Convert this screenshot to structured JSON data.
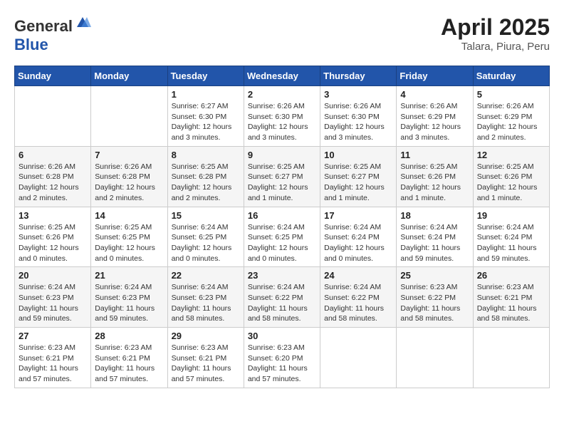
{
  "header": {
    "logo_general": "General",
    "logo_blue": "Blue",
    "month": "April 2025",
    "location": "Talara, Piura, Peru"
  },
  "weekdays": [
    "Sunday",
    "Monday",
    "Tuesday",
    "Wednesday",
    "Thursday",
    "Friday",
    "Saturday"
  ],
  "weeks": [
    [
      {
        "day": "",
        "info": ""
      },
      {
        "day": "",
        "info": ""
      },
      {
        "day": "1",
        "info": "Sunrise: 6:27 AM\nSunset: 6:30 PM\nDaylight: 12 hours and 3 minutes."
      },
      {
        "day": "2",
        "info": "Sunrise: 6:26 AM\nSunset: 6:30 PM\nDaylight: 12 hours and 3 minutes."
      },
      {
        "day": "3",
        "info": "Sunrise: 6:26 AM\nSunset: 6:30 PM\nDaylight: 12 hours and 3 minutes."
      },
      {
        "day": "4",
        "info": "Sunrise: 6:26 AM\nSunset: 6:29 PM\nDaylight: 12 hours and 3 minutes."
      },
      {
        "day": "5",
        "info": "Sunrise: 6:26 AM\nSunset: 6:29 PM\nDaylight: 12 hours and 2 minutes."
      }
    ],
    [
      {
        "day": "6",
        "info": "Sunrise: 6:26 AM\nSunset: 6:28 PM\nDaylight: 12 hours and 2 minutes."
      },
      {
        "day": "7",
        "info": "Sunrise: 6:26 AM\nSunset: 6:28 PM\nDaylight: 12 hours and 2 minutes."
      },
      {
        "day": "8",
        "info": "Sunrise: 6:25 AM\nSunset: 6:28 PM\nDaylight: 12 hours and 2 minutes."
      },
      {
        "day": "9",
        "info": "Sunrise: 6:25 AM\nSunset: 6:27 PM\nDaylight: 12 hours and 1 minute."
      },
      {
        "day": "10",
        "info": "Sunrise: 6:25 AM\nSunset: 6:27 PM\nDaylight: 12 hours and 1 minute."
      },
      {
        "day": "11",
        "info": "Sunrise: 6:25 AM\nSunset: 6:26 PM\nDaylight: 12 hours and 1 minute."
      },
      {
        "day": "12",
        "info": "Sunrise: 6:25 AM\nSunset: 6:26 PM\nDaylight: 12 hours and 1 minute."
      }
    ],
    [
      {
        "day": "13",
        "info": "Sunrise: 6:25 AM\nSunset: 6:26 PM\nDaylight: 12 hours and 0 minutes."
      },
      {
        "day": "14",
        "info": "Sunrise: 6:25 AM\nSunset: 6:25 PM\nDaylight: 12 hours and 0 minutes."
      },
      {
        "day": "15",
        "info": "Sunrise: 6:24 AM\nSunset: 6:25 PM\nDaylight: 12 hours and 0 minutes."
      },
      {
        "day": "16",
        "info": "Sunrise: 6:24 AM\nSunset: 6:25 PM\nDaylight: 12 hours and 0 minutes."
      },
      {
        "day": "17",
        "info": "Sunrise: 6:24 AM\nSunset: 6:24 PM\nDaylight: 12 hours and 0 minutes."
      },
      {
        "day": "18",
        "info": "Sunrise: 6:24 AM\nSunset: 6:24 PM\nDaylight: 11 hours and 59 minutes."
      },
      {
        "day": "19",
        "info": "Sunrise: 6:24 AM\nSunset: 6:24 PM\nDaylight: 11 hours and 59 minutes."
      }
    ],
    [
      {
        "day": "20",
        "info": "Sunrise: 6:24 AM\nSunset: 6:23 PM\nDaylight: 11 hours and 59 minutes."
      },
      {
        "day": "21",
        "info": "Sunrise: 6:24 AM\nSunset: 6:23 PM\nDaylight: 11 hours and 59 minutes."
      },
      {
        "day": "22",
        "info": "Sunrise: 6:24 AM\nSunset: 6:23 PM\nDaylight: 11 hours and 58 minutes."
      },
      {
        "day": "23",
        "info": "Sunrise: 6:24 AM\nSunset: 6:22 PM\nDaylight: 11 hours and 58 minutes."
      },
      {
        "day": "24",
        "info": "Sunrise: 6:24 AM\nSunset: 6:22 PM\nDaylight: 11 hours and 58 minutes."
      },
      {
        "day": "25",
        "info": "Sunrise: 6:23 AM\nSunset: 6:22 PM\nDaylight: 11 hours and 58 minutes."
      },
      {
        "day": "26",
        "info": "Sunrise: 6:23 AM\nSunset: 6:21 PM\nDaylight: 11 hours and 58 minutes."
      }
    ],
    [
      {
        "day": "27",
        "info": "Sunrise: 6:23 AM\nSunset: 6:21 PM\nDaylight: 11 hours and 57 minutes."
      },
      {
        "day": "28",
        "info": "Sunrise: 6:23 AM\nSunset: 6:21 PM\nDaylight: 11 hours and 57 minutes."
      },
      {
        "day": "29",
        "info": "Sunrise: 6:23 AM\nSunset: 6:21 PM\nDaylight: 11 hours and 57 minutes."
      },
      {
        "day": "30",
        "info": "Sunrise: 6:23 AM\nSunset: 6:20 PM\nDaylight: 11 hours and 57 minutes."
      },
      {
        "day": "",
        "info": ""
      },
      {
        "day": "",
        "info": ""
      },
      {
        "day": "",
        "info": ""
      }
    ]
  ]
}
